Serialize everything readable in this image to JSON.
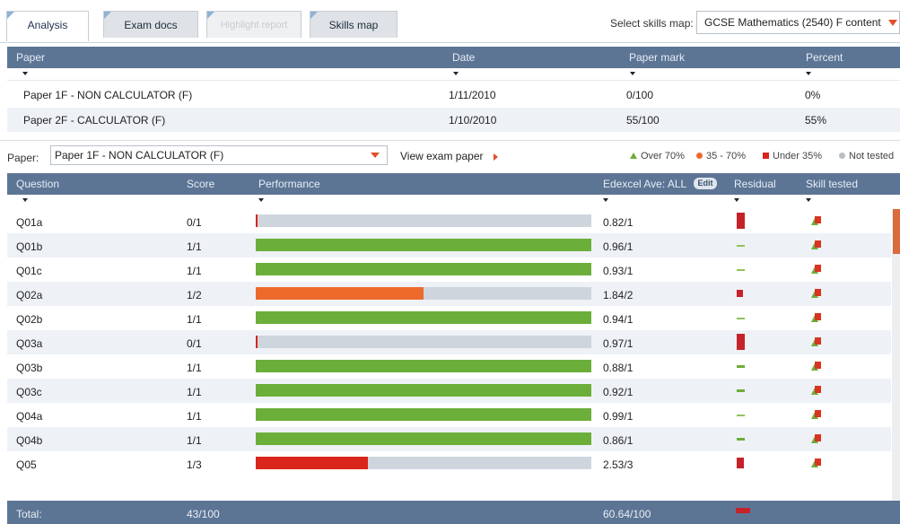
{
  "tabs": [
    {
      "label": "Analysis",
      "state": "active"
    },
    {
      "label": "Exam docs",
      "state": "normal"
    },
    {
      "label": "Highlight report",
      "state": "disabled"
    },
    {
      "label": "Skills map",
      "state": "normal"
    }
  ],
  "skills_map": {
    "label": "Select skills map:",
    "value": "GCSE Mathematics (2540) F content"
  },
  "papers_table": {
    "headers": {
      "paper": "Paper",
      "date": "Date",
      "mark": "Paper mark",
      "percent": "Percent"
    },
    "rows": [
      {
        "paper": "Paper 1F - NON CALCULATOR (F)",
        "date": "1/11/2010",
        "mark": "0/100",
        "percent": "0%"
      },
      {
        "paper": "Paper 2F - CALCULATOR (F)",
        "date": "1/10/2010",
        "mark": "55/100",
        "percent": "55%"
      }
    ]
  },
  "paper_select": {
    "label": "Paper:",
    "value": "Paper 1F - NON CALCULATOR (F)",
    "view_link": "View exam paper"
  },
  "legend": {
    "over70": "Over 70%",
    "mid": "35 - 70%",
    "under35": "Under 35%",
    "not_tested": "Not tested"
  },
  "colors": {
    "header": "#5d7595",
    "green": "#6cae3a",
    "orange": "#ee6a2c",
    "red": "#d9251b",
    "residual": "#c5222a"
  },
  "questions_table": {
    "headers": {
      "question": "Question",
      "score": "Score",
      "performance": "Performance",
      "average": "Edexcel Ave: ALL",
      "edit": "Edit",
      "residual": "Residual",
      "skill": "Skill tested"
    },
    "rows": [
      {
        "question": "Q01a",
        "score": "0/1",
        "fraction": 0.0,
        "band": "none",
        "average": "0.82/1",
        "residual": "neg_large"
      },
      {
        "question": "Q01b",
        "score": "1/1",
        "fraction": 1.0,
        "band": "green",
        "average": "0.96/1",
        "residual": "pos_tiny"
      },
      {
        "question": "Q01c",
        "score": "1/1",
        "fraction": 1.0,
        "band": "green",
        "average": "0.93/1",
        "residual": "pos_tiny"
      },
      {
        "question": "Q02a",
        "score": "1/2",
        "fraction": 0.5,
        "band": "orange",
        "average": "1.84/2",
        "residual": "neg_small"
      },
      {
        "question": "Q02b",
        "score": "1/1",
        "fraction": 1.0,
        "band": "green",
        "average": "0.94/1",
        "residual": "pos_tiny"
      },
      {
        "question": "Q03a",
        "score": "0/1",
        "fraction": 0.0,
        "band": "none",
        "average": "0.97/1",
        "residual": "neg_large"
      },
      {
        "question": "Q03b",
        "score": "1/1",
        "fraction": 1.0,
        "band": "green",
        "average": "0.88/1",
        "residual": "pos_small"
      },
      {
        "question": "Q03c",
        "score": "1/1",
        "fraction": 1.0,
        "band": "green",
        "average": "0.92/1",
        "residual": "pos_small"
      },
      {
        "question": "Q04a",
        "score": "1/1",
        "fraction": 1.0,
        "band": "green",
        "average": "0.99/1",
        "residual": "pos_tiny"
      },
      {
        "question": "Q04b",
        "score": "1/1",
        "fraction": 1.0,
        "band": "green",
        "average": "0.86/1",
        "residual": "pos_small"
      },
      {
        "question": "Q05",
        "score": "1/3",
        "fraction": 0.333,
        "band": "red",
        "average": "2.53/3",
        "residual": "neg_medium"
      }
    ]
  },
  "totals": {
    "label": "Total:",
    "score": "43/100",
    "average": "60.64/100"
  }
}
